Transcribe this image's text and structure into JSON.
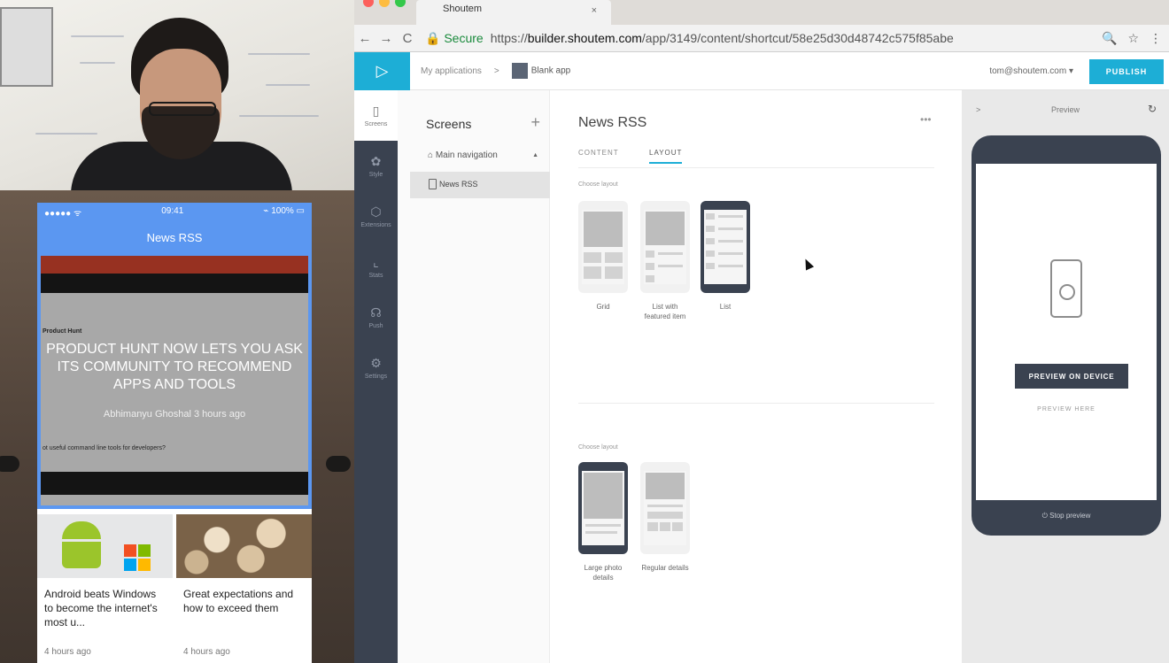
{
  "mobile": {
    "status_signal": "●●●●● ᯤ",
    "status_time": "09:41",
    "status_battery": "⌁ 100% ▭",
    "title": "News RSS",
    "hero": {
      "headline": "PRODUCT HUNT NOW LETS YOU ASK ITS COMMUNITY TO RECOMMEND APPS AND TOOLS",
      "meta": "Abhimanyu Ghoshal   3 hours ago",
      "bg_text_1": "Product Hunt",
      "bg_text_2": "ot useful command line tools for developers?"
    },
    "cards": [
      {
        "title": "Android beats Windows to become the internet's most u...",
        "time": "4 hours ago"
      },
      {
        "title": "Great expectations and how to exceed them",
        "time": "4 hours ago"
      }
    ]
  },
  "browser": {
    "tab_title": "Shoutem",
    "tab_close": "×",
    "back_icon": "←",
    "forward_icon": "→",
    "reload_icon": "C",
    "secure_label": "🔒 Secure",
    "url_scheme": "https://",
    "url_domain": "builder.shoutem.com",
    "url_path": "/app/3149/content/shortcut/58e25d30d48742c575f85abe",
    "zoom_icon": "🔍",
    "star_icon": "☆",
    "menu_icon": "⋮"
  },
  "app": {
    "logo": "▷",
    "breadcrumb": {
      "root": "My applications",
      "sep": ">",
      "app": "Blank app"
    },
    "user": "tom@shoutem.com ▾",
    "publish": "PUBLISH",
    "iconbar": [
      {
        "icon": "▯",
        "label": "Screens",
        "name": "screens"
      },
      {
        "icon": "✿",
        "label": "Style",
        "name": "style"
      },
      {
        "icon": "⬡",
        "label": "Extensions",
        "name": "extensions"
      },
      {
        "icon": "⌞",
        "label": "Stats",
        "name": "stats"
      },
      {
        "icon": "☊",
        "label": "Push",
        "name": "push"
      },
      {
        "icon": "⚙",
        "label": "Settings",
        "name": "settings"
      }
    ],
    "screens_panel": {
      "title": "Screens",
      "add": "+",
      "main_nav": "⌂  Main navigation",
      "caret": "▲",
      "selected": "News RSS"
    },
    "editor": {
      "title": "News RSS",
      "more": "•••",
      "tabs": {
        "content": "CONTENT",
        "layout": "LAYOUT"
      },
      "choose_layout_1": "Choose layout",
      "layouts_1": [
        {
          "label": "Grid"
        },
        {
          "label": "List with featured item"
        },
        {
          "label": "List"
        }
      ],
      "choose_layout_2": "Choose layout",
      "layouts_2": [
        {
          "label": "Large photo details"
        },
        {
          "label": "Regular details"
        }
      ]
    },
    "preview": {
      "collapse": ">",
      "title": "Preview",
      "refresh_icon": "↻",
      "btn_device": "PREVIEW ON DEVICE",
      "btn_here": "PREVIEW HERE",
      "stop": "⏻  Stop preview"
    }
  },
  "colors": {
    "brand": "#1daed6",
    "sidebar": "#3a4250",
    "mobile_header": "#5b97f1"
  }
}
